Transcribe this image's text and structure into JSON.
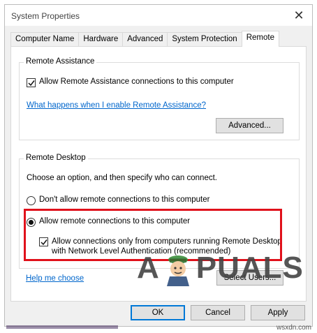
{
  "window": {
    "title": "System Properties",
    "close_glyph": "✕"
  },
  "tabs": [
    {
      "label": "Computer Name",
      "active": false
    },
    {
      "label": "Hardware",
      "active": false
    },
    {
      "label": "Advanced",
      "active": false
    },
    {
      "label": "System Protection",
      "active": false
    },
    {
      "label": "Remote",
      "active": true
    }
  ],
  "remote_assistance": {
    "legend": "Remote Assistance",
    "allow_label": "Allow Remote Assistance connections to this computer",
    "allow_checked": true,
    "help_link": "What happens when I enable Remote Assistance?",
    "advanced_button": "Advanced..."
  },
  "remote_desktop": {
    "legend": "Remote Desktop",
    "instructions": "Choose an option, and then specify who can connect.",
    "dont_allow_label": "Don't allow remote connections to this computer",
    "dont_allow_selected": false,
    "allow_label": "Allow remote connections to this computer",
    "allow_selected": true,
    "nla_label_line1": "Allow connections only from computers running Remote Desktop",
    "nla_label_line2": "with Network Level Authentication (recommended)",
    "nla_checked": true,
    "help_link": "Help me choose",
    "select_users_button": "Select Users..."
  },
  "footer": {
    "ok_button": "OK",
    "cancel_button": "Cancel",
    "apply_button": "Apply"
  },
  "watermark": {
    "text_left": "A",
    "text_right": "PUALS"
  },
  "source_tag": "wsxdn.com",
  "colors": {
    "highlight": "#e0111b",
    "link": "#0066cc",
    "accent": "#0078d7"
  }
}
